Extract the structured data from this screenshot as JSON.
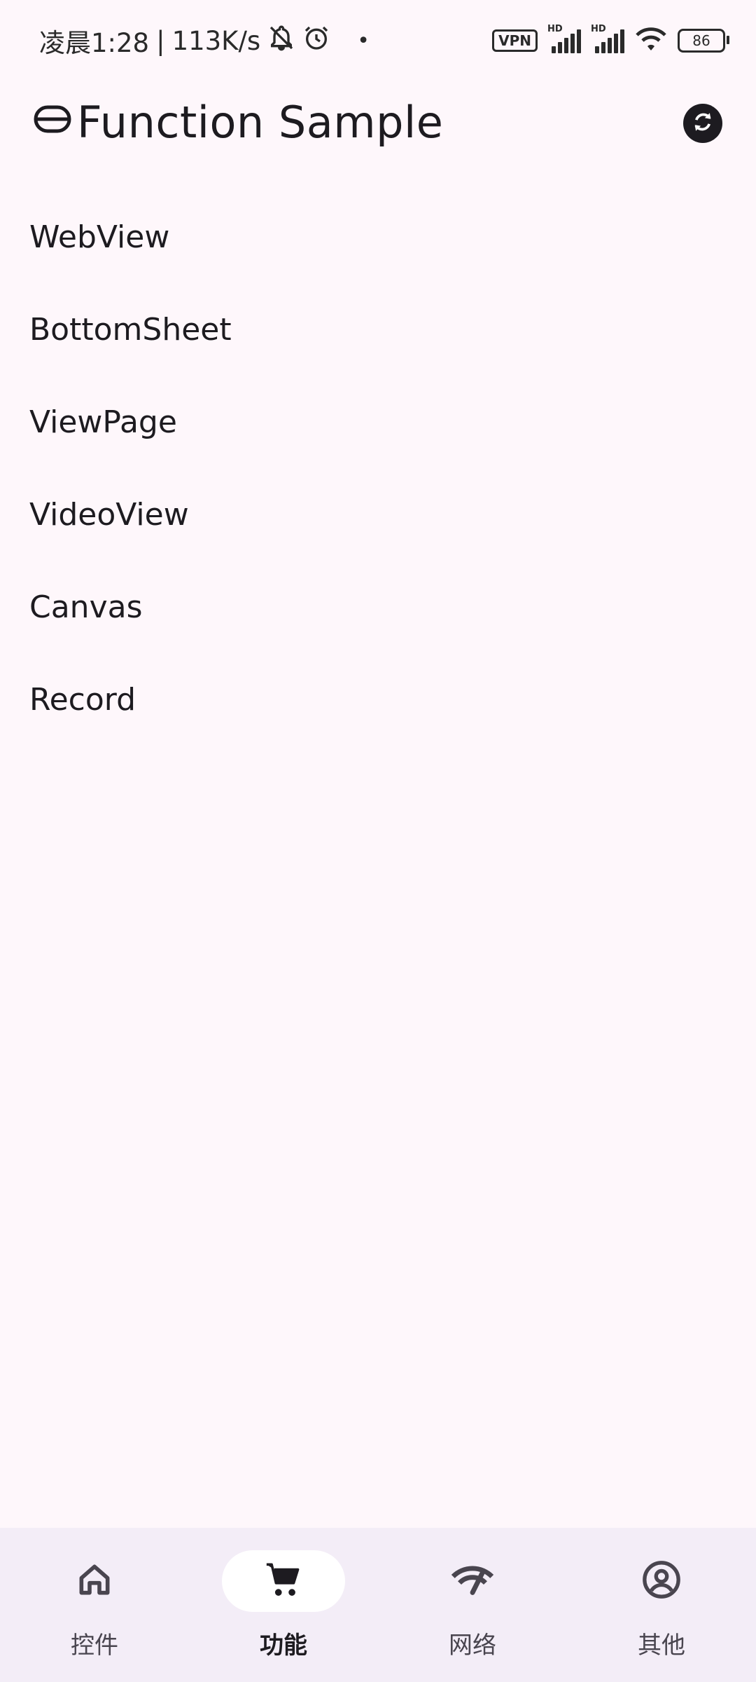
{
  "status_bar": {
    "time": "凌晨1:28",
    "separator": "|",
    "speed": "113K/s",
    "vpn": "VPN",
    "hd1": "HD",
    "hd2": "HD",
    "battery": "86"
  },
  "app_bar": {
    "title": "Function Sample"
  },
  "list": {
    "items": [
      {
        "label": "WebView"
      },
      {
        "label": "BottomSheet"
      },
      {
        "label": "ViewPage"
      },
      {
        "label": "VideoView"
      },
      {
        "label": "Canvas"
      },
      {
        "label": "Record"
      }
    ]
  },
  "bottom_nav": {
    "items": [
      {
        "label": "控件",
        "icon": "home-icon"
      },
      {
        "label": "功能",
        "icon": "cart-icon",
        "active": true
      },
      {
        "label": "网络",
        "icon": "network-icon"
      },
      {
        "label": "其他",
        "icon": "account-icon"
      }
    ]
  }
}
